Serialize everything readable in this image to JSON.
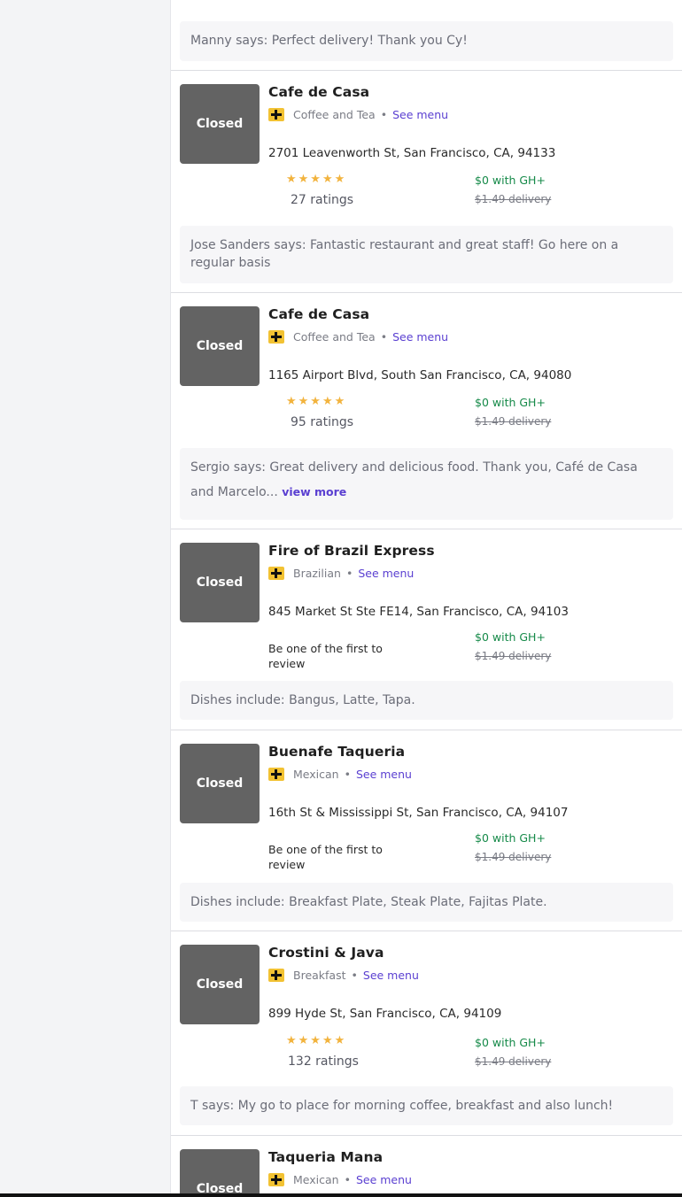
{
  "top_review": "Manny says: Perfect delivery! Thank you Cy!",
  "restaurants": [
    {
      "status": "Closed",
      "name": "Cafe de Casa",
      "cuisine": "Coffee and Tea",
      "see_menu": "See menu",
      "address": "2701 Leavenworth St, San Francisco, CA, 94133",
      "stars": "★★★★★",
      "rating": 4.5,
      "ratings_text": "27 ratings",
      "gh_plus": "$0 with GH+",
      "delivery_fee": "$1.49 delivery",
      "review": "Jose Sanders says: Fantastic restaurant and great staff! Go here on a regular basis"
    },
    {
      "status": "Closed",
      "name": "Cafe de Casa",
      "cuisine": "Coffee and Tea",
      "see_menu": "See menu",
      "address": "1165 Airport Blvd, South San Francisco, CA, 94080",
      "stars": "★★★★★",
      "rating": 4.5,
      "ratings_text": "95 ratings",
      "gh_plus": "$0 with GH+",
      "delivery_fee": "$1.49 delivery",
      "review": "Sergio says: Great delivery and delicious food. Thank you, Café de Casa and Marcelo...",
      "view_more": "view more"
    },
    {
      "status": "Closed",
      "name": "Fire of Brazil Express",
      "cuisine": "Brazilian",
      "see_menu": "See menu",
      "address": "845 Market St Ste FE14, San Francisco, CA, 94103",
      "first_review": "Be one of the first to review",
      "gh_plus": "$0 with GH+",
      "delivery_fee": "$1.49 delivery",
      "review": "Dishes include: Bangus, Latte, Tapa."
    },
    {
      "status": "Closed",
      "name": "Buenafe Taqueria",
      "cuisine": "Mexican",
      "see_menu": "See menu",
      "address": "16th St & Mississippi St, San Francisco, CA, 94107",
      "first_review": "Be one of the first to review",
      "gh_plus": "$0 with GH+",
      "delivery_fee": "$1.49 delivery",
      "review": "Dishes include: Breakfast Plate, Steak Plate, Fajitas Plate."
    },
    {
      "status": "Closed",
      "name": "Crostini & Java",
      "cuisine": "Breakfast",
      "see_menu": "See menu",
      "address": "899 Hyde St, San Francisco, CA, 94109",
      "stars": "★★★★★",
      "rating": 5,
      "ratings_text": "132 ratings",
      "gh_plus": "$0 with GH+",
      "delivery_fee": "$1.49 delivery",
      "review": "T says: My go to place for morning coffee, breakfast and also lunch!"
    },
    {
      "status": "Closed",
      "name": "Taqueria Mana",
      "cuisine": "Mexican",
      "see_menu": "See menu"
    }
  ],
  "separator": "•",
  "icons": {
    "gh_plus_badge": "gh-plus-icon",
    "star": "star-icon"
  },
  "colors": {
    "star": "#f2b33d",
    "gh_plus_badge": "#f2c233",
    "link": "#5a3fd1",
    "gh_plus_text": "#168a49",
    "closed_tile": "#636363"
  }
}
